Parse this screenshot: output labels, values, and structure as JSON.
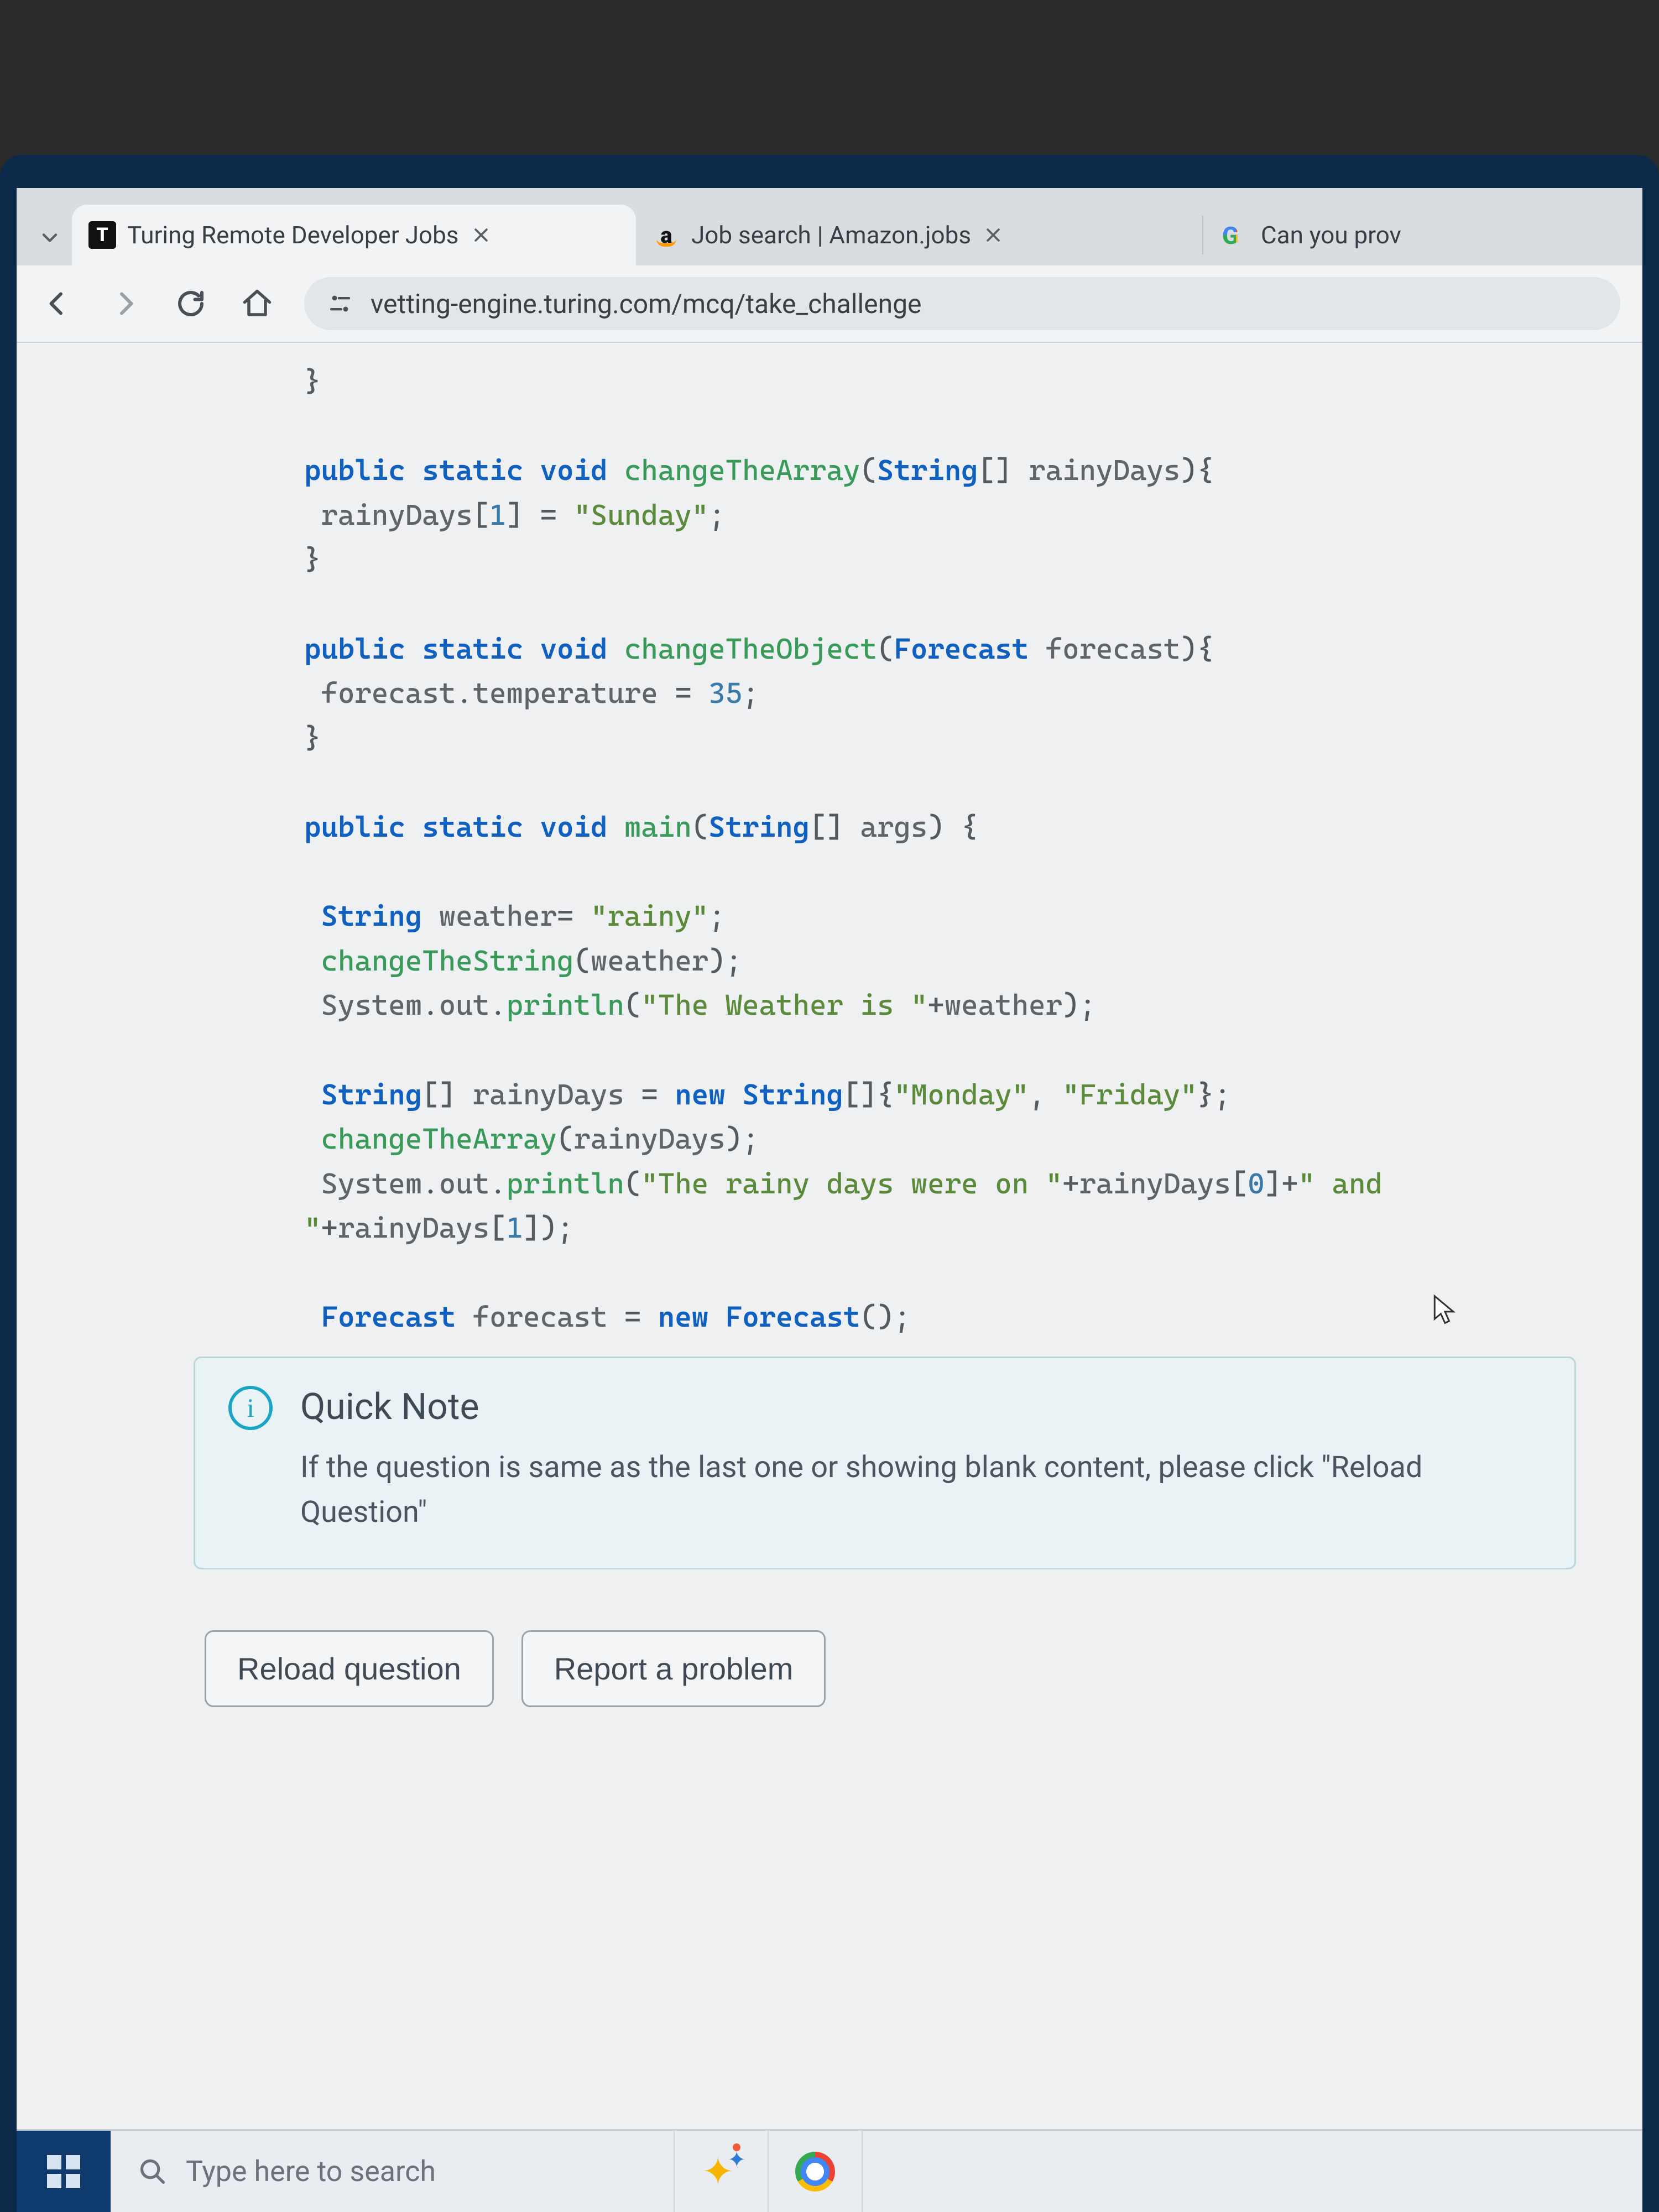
{
  "tabs": [
    {
      "title": "Turing Remote Developer Jobs",
      "active": true
    },
    {
      "title": "Job search | Amazon.jobs",
      "active": false
    },
    {
      "title": "Can you prov",
      "active": false
    }
  ],
  "address_url": "vetting-engine.turing.com/mcq/take_challenge",
  "code": {
    "l00": "}",
    "fn1_kw1": "public",
    "fn1_kw2": "static",
    "fn1_kw3": "void",
    "fn1_name": "changeTheArray",
    "fn1_param_type": "String",
    "fn1_param_name": "rainyDays",
    "fn1_body_arr": "rainyDays",
    "fn1_body_idx": "1",
    "fn1_body_val": "\"Sunday\"",
    "close_brace": "}",
    "fn2_name": "changeTheObject",
    "fn2_param_type": "Forecast",
    "fn2_param_name": "forecast",
    "fn2_body_obj": "forecast",
    "fn2_body_field": "temperature",
    "fn2_body_val": "35",
    "main_name": "main",
    "main_param_type": "String",
    "main_param_name": "args",
    "m1_type": "String",
    "m1_var": "weather",
    "m1_val": "\"rainy\"",
    "m2_call": "changeTheString",
    "m2_arg": "weather",
    "m3_obj": "System",
    "m3_f1": "out",
    "m3_f2": "println",
    "m3_str": "\"The Weather is \"",
    "m3_plus_var": "weather",
    "m4_type": "String",
    "m4_var": "rainyDays",
    "m4_new": "new",
    "m4_ctor": "String",
    "m4_v1": "\"Monday\"",
    "m4_v2": "\"Friday\"",
    "m5_call": "changeTheArray",
    "m5_arg": "rainyDays",
    "m6_str1": "\"The rainy days were on \"",
    "m6_arr": "rainyDays",
    "m6_i0": "0",
    "m6_str2": "\" and",
    "m6_cont": "\"",
    "m6_i1": "1",
    "m7_type": "Forecast",
    "m7_var": "forecast",
    "m7_new": "new",
    "m7_ctor": "Forecast"
  },
  "note": {
    "title": "Quick Note",
    "text": "If the question is same as the last one or showing blank content, please click \"Reload Question\""
  },
  "buttons": {
    "reload": "Reload question",
    "report": "Report a problem"
  },
  "taskbar": {
    "search_placeholder": "Type here to search"
  }
}
